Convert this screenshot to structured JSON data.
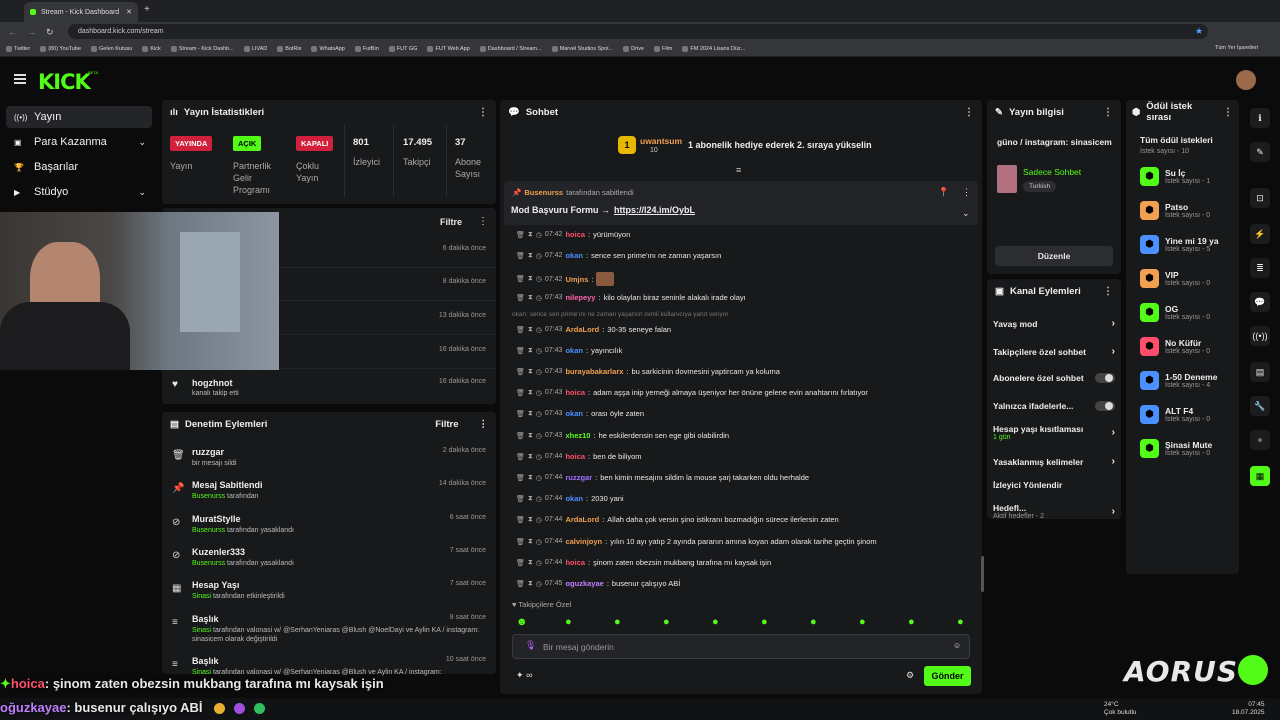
{
  "browser": {
    "tab_title": "Stream - Kick Dashboard",
    "url": "dashboard.kick.com/stream",
    "bookmarks": [
      "Twitter",
      "(80) YouTube",
      "Gelen Kutusu",
      "Kick",
      "Stream - Kick Dashb...",
      "LIVAD",
      "BotRix",
      "WhatsApp",
      "FutBin",
      "FUT GG",
      "FUT Web App",
      "Dashboard / Stream...",
      "Marvel Studios Spoi...",
      "Drive",
      "Film",
      "FM 2024 Lisans Düz..."
    ],
    "all_bookmarks": "Tüm Yer İşaretleri"
  },
  "brand": {
    "logo": "KICK",
    "beta": "BETA",
    "accent": "#53fc18"
  },
  "sidebar": {
    "items": [
      {
        "label": "Yayın",
        "icon": "broadcast-icon"
      },
      {
        "label": "Para Kazanma",
        "icon": "money-icon"
      },
      {
        "label": "Başarılar",
        "icon": "trophy-icon"
      },
      {
        "label": "Stüdyo",
        "icon": "studio-icon"
      }
    ]
  },
  "stats": {
    "title": "Yayın İstatistikleri",
    "live_badge": "YAYINDA",
    "live_label": "Yayın",
    "partner_badge": "AÇIK",
    "partner_label": "Partnerlik Gelir Programı",
    "multi_badge": "KAPALI",
    "multi_label": "Çoklu Yayın",
    "viewers": "801",
    "viewers_label": "İzleyici",
    "followers": "17.495",
    "followers_label": "Takipçi",
    "subs": "37",
    "subs_label": "Abone Sayısı"
  },
  "activity": {
    "filter": "Filtre",
    "items": [
      {
        "time": "6 dakika önce"
      },
      {
        "time": "8 dakika önce"
      },
      {
        "time": "13 dakika önce"
      },
      {
        "time": "16 dakika önce"
      },
      {
        "title": "hogzhnot",
        "sub": "kanalı takip etti",
        "time": "16 dakika önce"
      }
    ]
  },
  "moderation": {
    "title": "Denetim Eylemleri",
    "filter": "Filtre",
    "items": [
      {
        "title": "ruzzgar",
        "sub": "bir mesajı sildi",
        "time": "2 dakika önce"
      },
      {
        "title": "Mesaj Sabitlendi",
        "user": "Busenurss",
        "sub": "tarafından",
        "time": "14 dakika önce"
      },
      {
        "title": "MuratStylle",
        "user": "Busenurss",
        "sub": "tarafından yasaklandı",
        "time": "6 saat önce"
      },
      {
        "title": "Kuzenler333",
        "user": "Busenurss",
        "sub": "tarafından yasaklandı",
        "time": "7 saat önce"
      },
      {
        "title": "Hesap Yaşı",
        "user": "Sinasi",
        "sub": "tarafından etkinleştirildi",
        "time": "7 saat önce"
      },
      {
        "title": "Başlık",
        "user": "Sinasi",
        "sub": "tarafından valonasi w/ @SerhanYeniaras @Blush @NoelDayi ve Aylin KA / instagram: sinasicem olarak değiştirildi",
        "time": "8 saat önce"
      },
      {
        "title": "Başlık",
        "user": "Sinasi",
        "sub": "tarafından valonasi w/ @SerhanYeniaras @Blush ve Aylin KA / instagram:",
        "time": "10 saat önce"
      }
    ]
  },
  "chat": {
    "title": "Sohbet",
    "gift": {
      "user": "uwantsum",
      "count": "10",
      "text": "1 abonelik hediye ederek 2. sıraya yükselin"
    },
    "pinned": {
      "by": "Busenurss",
      "by_suffix": "tarafından sabitlendi",
      "text": "Mod Başvuru Formu →",
      "link": "https://l24.im/OybL"
    },
    "reply_hint": "okan: sence sen prime'ını ne zaman yaşarsın isimli kullanıcıya yanıt veriyor",
    "messages": [
      {
        "time": "07:42",
        "user": "hoica",
        "color": "#ff4f6b",
        "text": "yürümüyon"
      },
      {
        "time": "07:42",
        "user": "okan",
        "color": "#4a90ff",
        "text": "sence sen prime'ını ne zaman yaşarsın"
      },
      {
        "time": "07:42",
        "user": "Umjns",
        "color": "#f0a050",
        "text": ""
      },
      {
        "time": "07:43",
        "user": "nilepeyy",
        "color": "#ff66aa",
        "text": "kilo olayları biraz seninle alakalı irade olayı"
      },
      {
        "time": "07:43",
        "user": "ArdaLord",
        "color": "#f0a050",
        "text": "30-35 seneye falan"
      },
      {
        "time": "07:43",
        "user": "okan",
        "color": "#4a90ff",
        "text": "yayıncılık"
      },
      {
        "time": "07:43",
        "user": "burayabakarlarx",
        "color": "#f0a050",
        "text": "bu sarkicinin dovmesini yaptircam ya koluma"
      },
      {
        "time": "07:43",
        "user": "hoica",
        "color": "#ff4f6b",
        "text": "adam aşşa inip yemeği almaya üşeniyor her önüne gelene evin anahtarını fırlatıyor"
      },
      {
        "time": "07:43",
        "user": "okan",
        "color": "#4a90ff",
        "text": "orası öyle zaten"
      },
      {
        "time": "07:43",
        "user": "xhez10",
        "color": "#53fc18",
        "text": "he eskilerdensin sen ege gibi olabilirdin"
      },
      {
        "time": "07:44",
        "user": "hoica",
        "color": "#ff4f6b",
        "text": "ben de biliyom"
      },
      {
        "time": "07:44",
        "user": "ruzzgar",
        "color": "#a070ff",
        "text": "ben kimin mesajını sildim la mouse şarj takarken oldu herhalde"
      },
      {
        "time": "07:44",
        "user": "okan",
        "color": "#4a90ff",
        "text": "2030 yani"
      },
      {
        "time": "07:44",
        "user": "ArdaLord",
        "color": "#f0a050",
        "text": "Allah daha çok versin şino istikranı bozmadığın sürece ilerlersin zaten"
      },
      {
        "time": "07:44",
        "user": "calvinjoyn",
        "color": "#f0a050",
        "text": "yılın 10 ayı yatıp 2 ayında paranın amına koyan adam olarak tarihe geçtin şinom"
      },
      {
        "time": "07:44",
        "user": "hoica",
        "color": "#ff4f6b",
        "text": "şinom zaten obezsin mukbang tarafına mı kaysak işin"
      },
      {
        "time": "07:45",
        "user": "oguzkayae",
        "color": "#c080ff",
        "text": "busenur çalışıyo ABİ"
      }
    ],
    "followers_only": "Takipçilere Özel",
    "input_placeholder": "Bir mesaj gönderin",
    "send": "Gönder",
    "points": "∞"
  },
  "stream_info": {
    "title": "Yayın bilgisi",
    "stream_title": "güno / instagram: sinasicem",
    "category": "Sadece Sohbet",
    "tag": "Turkish",
    "edit": "Düzenle"
  },
  "channel_actions": {
    "title": "Kanal Eylemleri",
    "items": [
      {
        "label": "Yavaş mod"
      },
      {
        "label": "Takipçilere özel sohbet"
      },
      {
        "label": "Abonelere özel sohbet"
      },
      {
        "label": "Yalnızca ifadelerle..."
      },
      {
        "label": "Hesap yaşı kısıtlaması",
        "sub": "1 gün"
      },
      {
        "label": "Yasaklanmış kelimeler"
      },
      {
        "label": "İzleyici Yönlendir"
      },
      {
        "label": "Hedefl...",
        "sub": "Aktif hedefler - 2"
      }
    ]
  },
  "rewards": {
    "title": "Ödül istek sırası",
    "all": "Tüm ödül istekleri",
    "all_sub": "İstek sayısı - 10",
    "items": [
      {
        "label": "Su İç",
        "sub": "İstek sayısı - 1",
        "color": "#53fc18"
      },
      {
        "label": "Patso",
        "sub": "İstek sayısı - 0",
        "color": "#f0a050"
      },
      {
        "label": "Yine mi 19 ya",
        "sub": "İstek sayısı - 5",
        "color": "#4a90ff"
      },
      {
        "label": "VIP",
        "sub": "İstek sayısı - 0",
        "color": "#f0a050"
      },
      {
        "label": "OG",
        "sub": "İstek sayısı - 0",
        "color": "#53fc18"
      },
      {
        "label": "No Küfür",
        "sub": "İstek sayısı - 0",
        "color": "#ff4f6b"
      },
      {
        "label": "1-50 Deneme",
        "sub": "İstek sayısı - 4",
        "color": "#4a90ff"
      },
      {
        "label": "ALT F4",
        "sub": "İstek sayısı - 0",
        "color": "#4a90ff"
      },
      {
        "label": "Şinasi Mute",
        "sub": "İstek sayısı - 0",
        "color": "#53fc18"
      }
    ]
  },
  "overlay": {
    "line1_user": "hoica",
    "line1_text": ": şinom zaten obezsin mukbang tarafına mı kaysak işin",
    "line2_user": "oğuzkayae",
    "line2_text": ": busenur çalışıyo ABİ",
    "brand": "AORUS"
  },
  "taskbar": {
    "weather": "24°C",
    "weather_sub": "Çok bulutlu",
    "time": "07:45",
    "date": "18.07.2025"
  }
}
